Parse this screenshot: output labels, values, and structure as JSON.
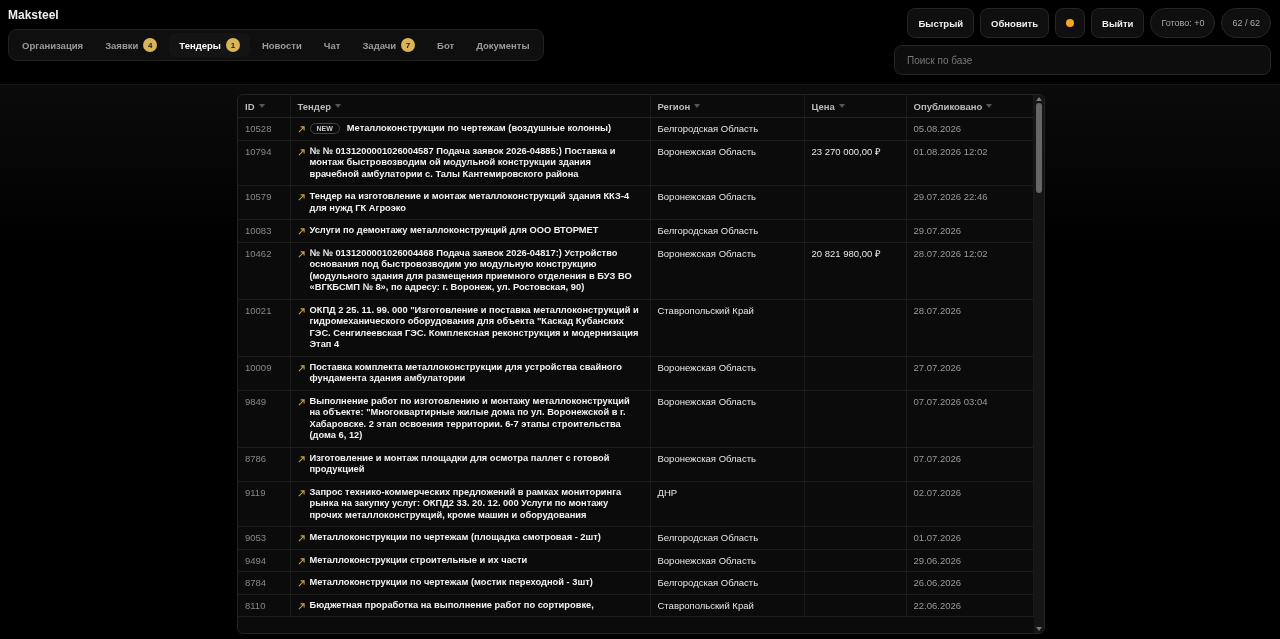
{
  "app_title": "Maksteel",
  "tabs": [
    {
      "label": "Организация",
      "selected": false
    },
    {
      "label": "Заявки",
      "badge": "4",
      "selected": false
    },
    {
      "label": "Тендеры",
      "badge": "1",
      "selected": true
    },
    {
      "label": "Новости",
      "selected": false
    },
    {
      "label": "Чат",
      "selected": false
    },
    {
      "label": "Задачи",
      "badge": "7",
      "selected": false
    },
    {
      "label": "Бот",
      "selected": false
    },
    {
      "label": "Документы",
      "selected": false
    }
  ],
  "toolbar": [
    {
      "kind": "button",
      "label": "Быстрый"
    },
    {
      "kind": "button",
      "label": "Обновить"
    },
    {
      "kind": "dot",
      "color": "#f5a623"
    },
    {
      "kind": "button",
      "label": "Выйти"
    },
    {
      "kind": "pill",
      "label": "Готово: +0"
    },
    {
      "kind": "pill",
      "label": "62 / 62"
    }
  ],
  "search": {
    "placeholder": "Поиск по базе"
  },
  "table": {
    "columns": [
      "ID",
      "Тендер",
      "Регион",
      "Цена",
      "Опубликовано"
    ],
    "rows": [
      {
        "id": "10528",
        "badge": "NEW",
        "title": "Металлоконструкции по чертежам (воздушные колонны)",
        "region": "Белгородская Область",
        "price": "",
        "published": "05.08.2026"
      },
      {
        "id": "10794",
        "title": "№ № 0131200001026004587 Подача заявок 2026-04885:) Поставка и монтаж быстровозводим ой модульной конструкции здания врачебной амбулатории с. Талы Кантемировского района",
        "region": "Воронежская Область",
        "price": "23 270 000,00 ₽",
        "published": "01.08.2026 12:02"
      },
      {
        "id": "10579",
        "title": "Тендер на изготовление и монтаж металлоконструкций здания ККЗ-4 для нужд ГК Агроэко",
        "region": "Воронежская Область",
        "price": "",
        "published": "29.07.2026 22:46"
      },
      {
        "id": "10083",
        "title": "Услуги по демонтажу металлоконструкций для ООО ВТОРМЕТ",
        "region": "Белгородская Область",
        "price": "",
        "published": "29.07.2026"
      },
      {
        "id": "10462",
        "title": "№ № 0131200001026004468 Подача заявок 2026-04817:) Устройство основания под быстровозводим ую модульную конструкцию (модульного здания для размещения приемного отделения в БУЗ ВО «ВГКБСМП № 8», по адресу: г. Воронеж, ул. Ростовская, 90)",
        "region": "Воронежская Область",
        "price": "20 821 980,00 ₽",
        "published": "28.07.2026 12:02"
      },
      {
        "id": "10021",
        "title": "ОКПД 2 25. 11. 99. 000 \"Изготовление и поставка металлоконструкций и гидромеханического оборудования для объекта \"Каскад Кубанских ГЭС. Сенгилеевская ГЭС. Комплексная реконструкция и модернизация Этап 4",
        "region": "Ставропольский Край",
        "price": "",
        "published": "28.07.2026"
      },
      {
        "id": "10009",
        "title": "Поставка комплекта металлоконструкции для устройства свайного фундамента здания амбулатории",
        "region": "Воронежская Область",
        "price": "",
        "published": "27.07.2026"
      },
      {
        "id": "9849",
        "title": "Выполнение работ по изготовлению и монтажу металлоконструкций на объекте: \"Многоквартирные жилые дома по ул. Воронежской в г. Хабаровске. 2 этап освоения территории. 6-7 этапы строительства (дома 6, 12)",
        "region": "Воронежская Область",
        "price": "",
        "published": "07.07.2026 03:04"
      },
      {
        "id": "8786",
        "title": "Изготовление и монтаж площадки для осмотра паллет с готовой продукцией",
        "region": "Воронежская Область",
        "price": "",
        "published": "07.07.2026"
      },
      {
        "id": "9119",
        "title": "Запрос технико-коммерческих предложений в рамках мониторинга рынка на закупку услуг: ОКПД2 33. 20. 12. 000 Услуги по монтажу прочих металлоконструкций, кроме машин и оборудования",
        "region": "ДНР",
        "price": "",
        "published": "02.07.2026"
      },
      {
        "id": "9053",
        "title": "Металлоконструкции по чертежам (площадка смотровая - 2шт)",
        "region": "Белгородская Область",
        "price": "",
        "published": "01.07.2026"
      },
      {
        "id": "9494",
        "title": "Металлоконструкции строительные и их части",
        "region": "Воронежская Область",
        "price": "",
        "published": "29.06.2026"
      },
      {
        "id": "8784",
        "title": "Металлоконструкции по чертежам (мостик переходной - 3шт)",
        "region": "Белгородская Область",
        "price": "",
        "published": "26.06.2026"
      },
      {
        "id": "8110",
        "title": "Бюджетная проработка на выполнение работ по сортировке,",
        "region": "Ставропольский Край",
        "price": "",
        "published": "22.06.2026"
      }
    ]
  }
}
